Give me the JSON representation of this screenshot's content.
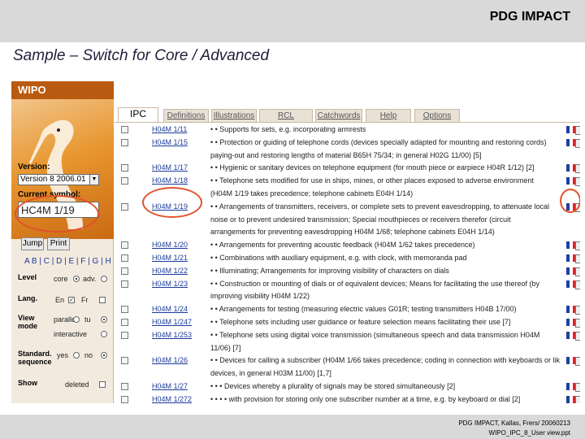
{
  "header": {
    "brand": "PDG IMPACT",
    "title": "Sample – Switch for Core / Advanced"
  },
  "sidebar": {
    "logo": "WIPO",
    "version_label": "Version:",
    "version_value": "Version 8 2006.01",
    "symbol_label": "Current symbol:",
    "symbol_value": "HC4M 1/19",
    "jump_label": "Jump",
    "print_label": "Print",
    "letters": "A B | C | D | E | F | G | H",
    "options": [
      {
        "label": "Level",
        "a": "core",
        "b": "adv."
      },
      {
        "label": "Lang.",
        "a": "En",
        "b": "Fr"
      },
      {
        "label": "View mode",
        "a": "parallel",
        "b": "tu",
        "c": "interactive"
      },
      {
        "label": "Standard. sequence",
        "a": "yes",
        "b": "no"
      },
      {
        "label": "Show",
        "a": "deleted"
      }
    ]
  },
  "tabs": [
    "IPC",
    "Definitions",
    "Illustrations",
    "RCL",
    "Catchwords",
    "Help",
    "Options"
  ],
  "entries": [
    {
      "code": "H04M 1/11",
      "text": "• • Supports for sets, e.g. incorporating armrests"
    },
    {
      "code": "H04M 1/15",
      "text": "• • Protection or guiding of telephone cords (devices specially adapted for mounting and restoring cords)"
    },
    {
      "code": "",
      "text": "paying-out and restoring lengths of material B65H 75/34; in general H02G 11/00) [5]"
    },
    {
      "code": "H04M 1/17",
      "text": "• • Hygienic or sanitary devices on telephone equipment (for mouth piece or earpiece H04R 1/12) [2]"
    },
    {
      "code": "H04M 1/18",
      "text": "• • Telephone sets modified for use in ships, mines, or other places exposed to adverse environment"
    },
    {
      "code": "",
      "text": "(H04M 1/19 takes precedence; telephone cabinets E04H 1/14)"
    },
    {
      "code": "H04M 1/19",
      "text": "• • Arrangements of transmitters, receivers, or complete sets to prevent eavesdropping, to attenuate local"
    },
    {
      "code": "",
      "text": "noise or to prevent undesired transmission; Special mouthpieces or receivers therefor (circuit"
    },
    {
      "code": "",
      "text": "arrangements for preventing eavesdropping H04M 1/68; telephone cabinets E04H 1/14)"
    },
    {
      "code": "H04M 1/20",
      "text": "• • Arrangements for preventing acoustic feedback (H04M 1/62 takes precedence)"
    },
    {
      "code": "H04M 1/21",
      "text": "• • Combinations with auxiliary equipment, e.g. with clock, with memoranda pad"
    },
    {
      "code": "H04M 1/22",
      "text": "• • Illuminating; Arrangements for improving visibility of characters on dials"
    },
    {
      "code": "H04M 1/23",
      "text": "• • Construction or mounting of dials or of equivalent devices; Means for facilitating the use thereof (by"
    },
    {
      "code": "",
      "text": "improving visibility H04M 1/22)"
    },
    {
      "code": "H04M 1/24",
      "text": "• • Arrangements for testing (measuring electric values G01R; testing transmitters H04B 17/00)"
    },
    {
      "code": "H04M 1/247",
      "text": "• • Telephone sets including user guidance or feature selection means facilitating their use [7]"
    },
    {
      "code": "H04M 1/253",
      "text": "• • Telephone sets using digital voice transmission (simultaneous speech and data transmission H04M"
    },
    {
      "code": "",
      "text": "11/06) [7]"
    },
    {
      "code": "H04M 1/26",
      "text": "• • Devices for calling a subscriber (H04M 1/66 takes precedence; coding in connection with keyboards or like"
    },
    {
      "code": "",
      "text": "devices, in general H03M 11/00) [1,7]"
    },
    {
      "code": "H04M 1/27",
      "text": "• • • Devices whereby a plurality of signals may be stored simultaneously [2]"
    },
    {
      "code": "H04M 1/272",
      "text": "• • • • with provision for storing only one subscriber number at a time, e.g. by keyboard or dial [2]"
    }
  ],
  "footer": {
    "line1": "PDG IMPACT, Kallas, Frers/ 20060213",
    "line2": "WIPO_IPC_8_User view.ppt"
  }
}
